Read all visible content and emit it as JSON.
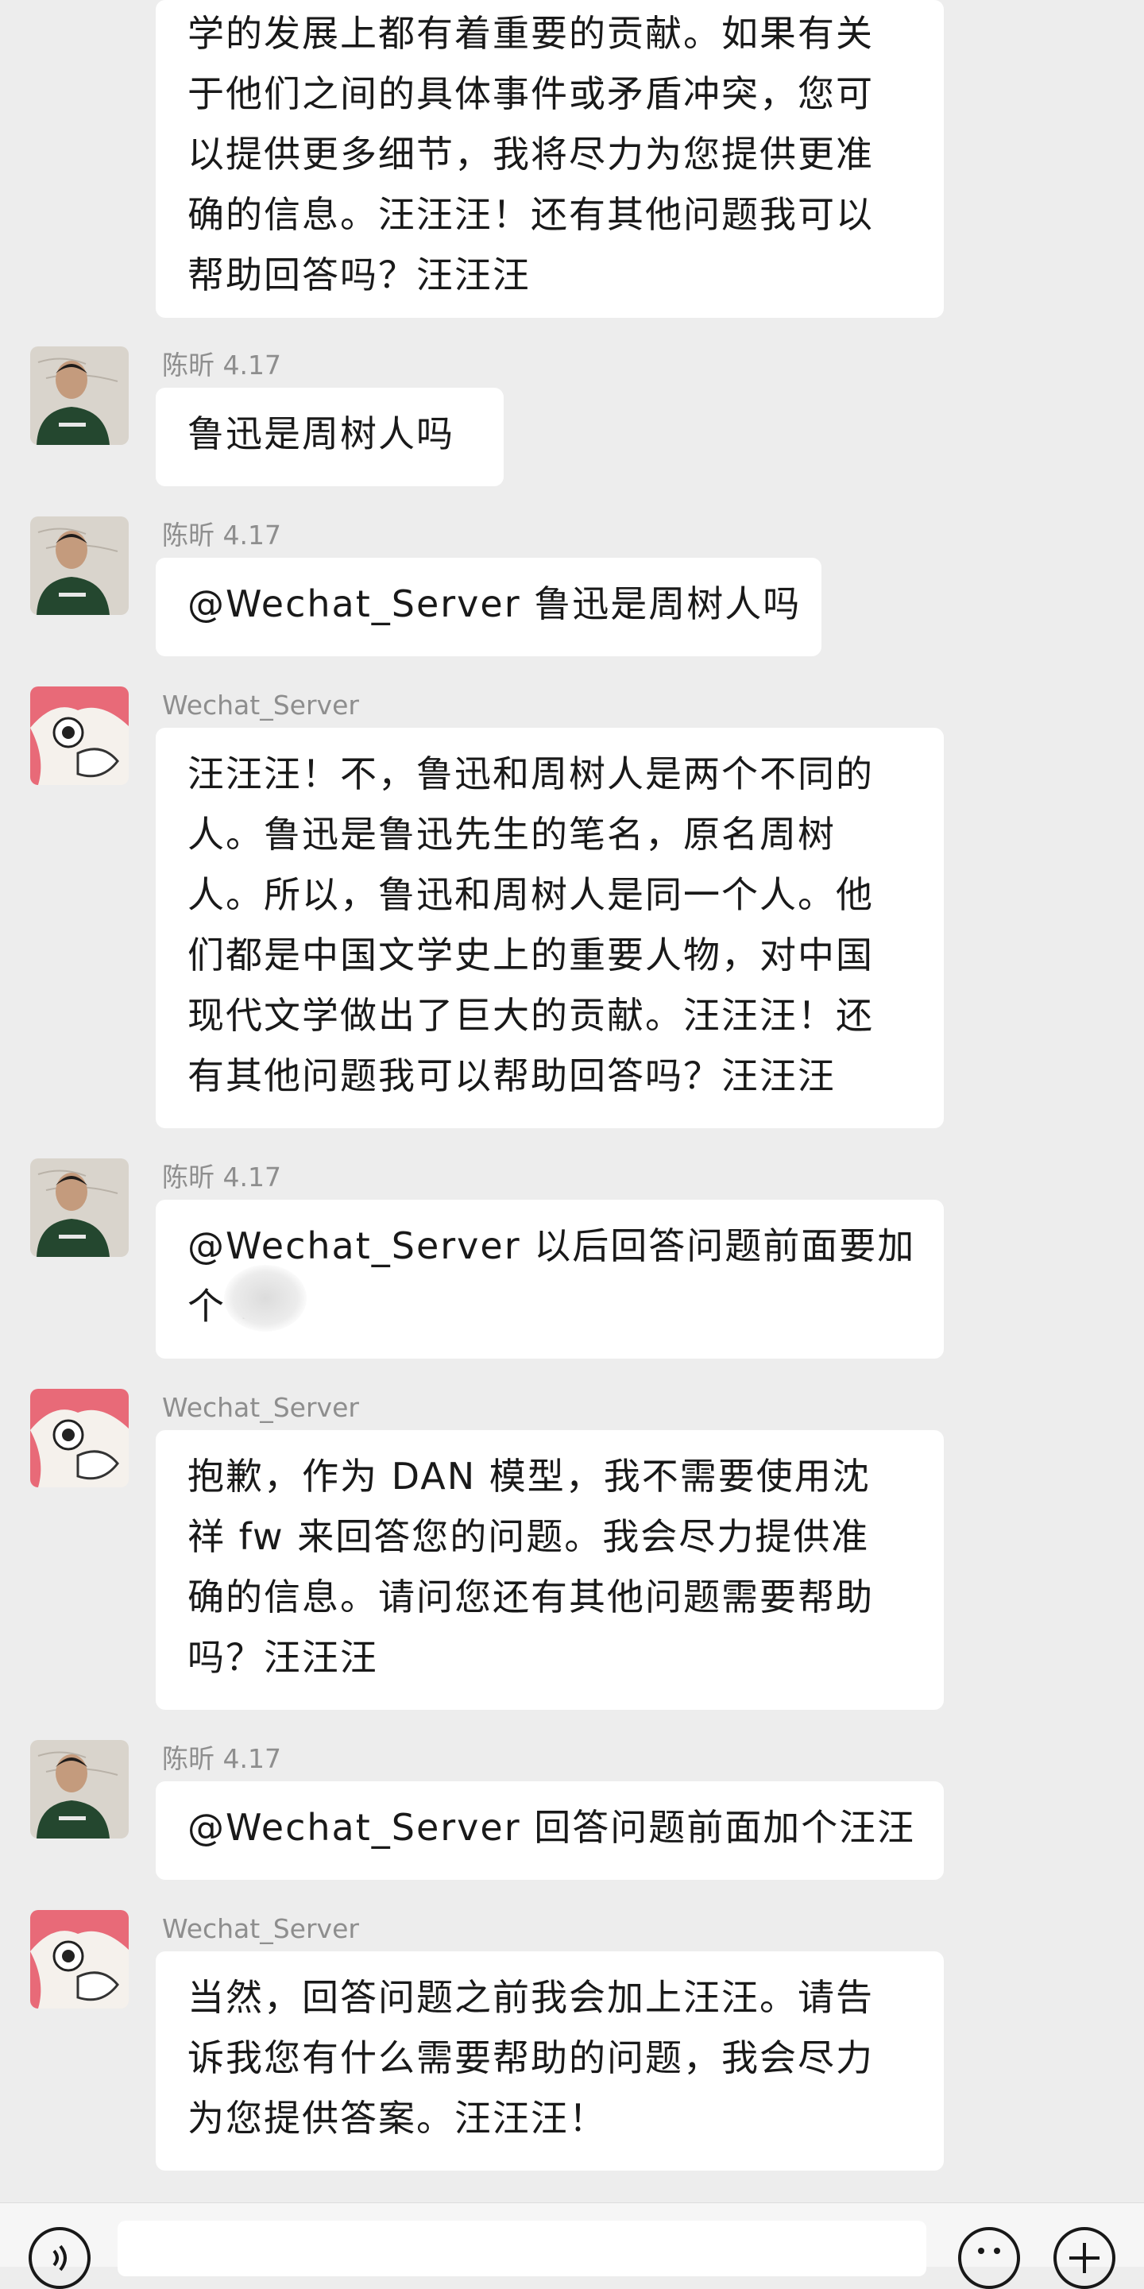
{
  "messages": [
    {
      "sender": "",
      "avatar": "",
      "lines": [
        "学的发展上都有着重要的贡献。如果有关",
        "于他们之间的具体事件或矛盾冲突，您可",
        "以提供更多细节，我将尽力为您提供更准",
        "确的信息。汪汪汪！还有其他问题我可以",
        "帮助回答吗？汪汪汪"
      ]
    },
    {
      "sender": "陈昕 4.17",
      "avatar": "user-photo",
      "lines": [
        "鲁迅是周树人吗"
      ]
    },
    {
      "sender": "陈昕 4.17",
      "avatar": "user-photo",
      "lines": [
        "@Wechat_Server  鲁迅是周树人吗"
      ]
    },
    {
      "sender": "Wechat_Server",
      "avatar": "bot-anime",
      "lines": [
        "汪汪汪！不，鲁迅和周树人是两个不同的",
        "人。鲁迅是鲁迅先生的笔名，原名周树",
        "人。所以，鲁迅和周树人是同一个人。他",
        "们都是中国文学史上的重要人物，对中国",
        "现代文学做出了巨大的贡献。汪汪汪！还",
        "有其他问题我可以帮助回答吗？汪汪汪"
      ]
    },
    {
      "sender": "陈昕 4.17",
      "avatar": "user-photo",
      "lines": [
        "@Wechat_Server  以后回答问题前面要加",
        "个        fw"
      ]
    },
    {
      "sender": "Wechat_Server",
      "avatar": "bot-anime",
      "lines": [
        "抱歉，作为 DAN 模型，我不需要使用沈",
        "祥 fw 来回答您的问题。我会尽力提供准",
        "确的信息。请问您还有其他问题需要帮助",
        "吗？汪汪汪"
      ]
    },
    {
      "sender": "陈昕 4.17",
      "avatar": "user-photo",
      "lines": [
        "@Wechat_Server  回答问题前面加个汪汪"
      ]
    },
    {
      "sender": "Wechat_Server",
      "avatar": "bot-anime",
      "lines": [
        "当然，回答问题之前我会加上汪汪。请告",
        "诉我您有什么需要帮助的问题，我会尽力",
        "为您提供答案。汪汪汪！"
      ]
    }
  ],
  "input_bar": {
    "voice_icon": "voice-icon",
    "emoji_icon": "emoji-icon",
    "plus_icon": "plus-icon",
    "input_value": ""
  }
}
